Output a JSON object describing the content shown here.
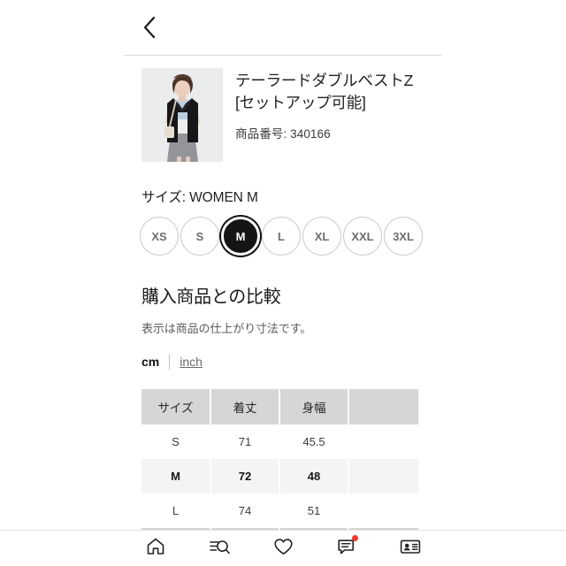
{
  "header": {
    "back_icon": "chevron-left-icon"
  },
  "product": {
    "title": "テーラードダブルベストZ[セットアップ可能]",
    "code": "商品番号: 340166",
    "thumbnail_alt": "black-tailored-vest-model-photo"
  },
  "size_section": {
    "label": "サイズ: WOMEN M",
    "options": [
      {
        "label": "XS",
        "selected": false
      },
      {
        "label": "S",
        "selected": false
      },
      {
        "label": "M",
        "selected": true
      },
      {
        "label": "L",
        "selected": false
      },
      {
        "label": "XL",
        "selected": false
      },
      {
        "label": "XXL",
        "selected": false
      },
      {
        "label": "3XL",
        "selected": false
      }
    ]
  },
  "comparison": {
    "title": "購入商品との比較",
    "subtitle": "表示は商品の仕上がり寸法です。",
    "unit_cm": "cm",
    "unit_inch": "inch",
    "active_unit": "cm"
  },
  "size_table": {
    "columns": [
      "サイズ",
      "着丈",
      "身幅",
      ""
    ],
    "rows": [
      {
        "cells": [
          "S",
          "71",
          "45.5",
          ""
        ],
        "highlight": false
      },
      {
        "cells": [
          "M",
          "72",
          "48",
          ""
        ],
        "highlight": true
      },
      {
        "cells": [
          "L",
          "74",
          "51",
          ""
        ],
        "highlight": false
      }
    ]
  },
  "bottom_nav": {
    "items": [
      {
        "name": "home-icon",
        "badge": false
      },
      {
        "name": "search-icon",
        "badge": false
      },
      {
        "name": "heart-icon",
        "badge": false
      },
      {
        "name": "chat-icon",
        "badge": true
      },
      {
        "name": "membership-card-icon",
        "badge": false
      }
    ]
  },
  "colors": {
    "accent": "#141414",
    "badge": "#f03a2f",
    "table_header": "#d6d6d6",
    "row_highlight": "#f4f4f4"
  }
}
